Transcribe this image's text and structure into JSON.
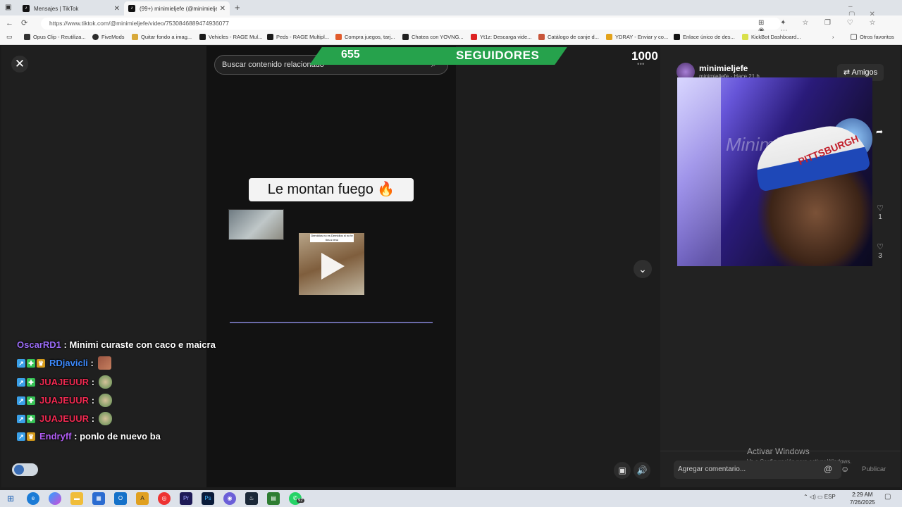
{
  "browser": {
    "tabs": [
      {
        "title": "Mensajes | TikTok"
      },
      {
        "title": "(99+) minimieljefe (@minimieljefe"
      }
    ],
    "url": "https://www.tiktok.com/@minimieljefe/video/7530846889474936077",
    "bookmarks": [
      "Opus Clip - Reutiliza...",
      "FiveMods",
      "Quitar fondo a imag...",
      "Vehicles - RAGE Mul...",
      "Peds - RAGE Multipl...",
      "Compra juegos, tarj...",
      "Chatea con YOVNG...",
      "Yt1z: Descarga vide...",
      "Catálogo de canje d...",
      "YDRAY - Enviar y co...",
      "Enlace único de des...",
      "KickBot Dashboard..."
    ],
    "other_favorites": "Otros favoritos"
  },
  "video": {
    "search_placeholder": "Buscar contenido relacionado",
    "caption": "Le montan fuego 🔥",
    "thumb_caption": "Demidios no es Demidios si no te tira a reno"
  },
  "overlay": {
    "followers_current": "655",
    "followers_label": "SEGUIDORES",
    "followers_goal": "1000"
  },
  "chat": [
    {
      "user": "OscarRD1",
      "color": "#9b6cf7",
      "message": "Minimi curaste con caco e maicra",
      "badges": []
    },
    {
      "user": "RDjavicli",
      "color": "#3d8bff",
      "message": "",
      "badges": [
        "blue",
        "green",
        "crown"
      ],
      "emote": "face"
    },
    {
      "user": "JUAJEUUR",
      "color": "#ef2a51",
      "message": "",
      "badges": [
        "blue",
        "green"
      ],
      "emote": "guy"
    },
    {
      "user": "JUAJEUUR",
      "color": "#ef2a51",
      "message": "",
      "badges": [
        "blue",
        "green"
      ],
      "emote": "guy"
    },
    {
      "user": "JUAJEUUR",
      "color": "#ef2a51",
      "message": "",
      "badges": [
        "blue",
        "green"
      ],
      "emote": "guy"
    },
    {
      "user": "Endryff",
      "color": "#b05cf2",
      "message": "ponlo de nuevo ba",
      "badges": [
        "blue",
        "crown"
      ]
    }
  ],
  "right_panel": {
    "channel_name": "minimieljefe",
    "channel_sub": "minimieljefe · Hace 21 h",
    "amigos_label": "Amigos",
    "likes": [
      "1",
      "3"
    ],
    "comment_placeholder": "Agregar comentario...",
    "publish_label": "Publicar",
    "cam_cap_text": "PITTSBURGH",
    "cam_watermark": "Minimi"
  },
  "windows": {
    "activate_title": "Activar Windows",
    "activate_sub": "Ve a Configuración para activar Windows.",
    "lang": "ESP",
    "time": "2:29 AM",
    "date": "7/26/2025",
    "whatsapp_badge": "92"
  }
}
